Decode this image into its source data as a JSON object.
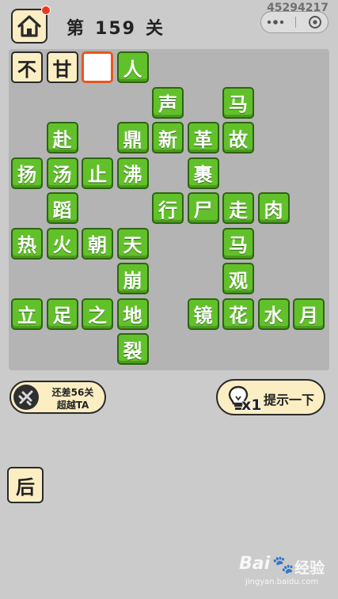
{
  "header": {
    "level_prefix": "第",
    "level_number": "159",
    "level_suffix": "关",
    "corner_id": "45294217"
  },
  "board": {
    "grid": [
      "不甘_人",
      "    声 马",
      " 赴 鼎新革故",
      "扬汤止沸 裹",
      " 蹈  行尸走肉",
      "热火朝天  马",
      "   崩  观",
      "立足之地 镜花水月",
      "   裂"
    ]
  },
  "progress": {
    "line1": "还差56关",
    "line2": "超越TA"
  },
  "hint": {
    "count": "x1",
    "label": "提示一下"
  },
  "side_button": {
    "label": "后"
  },
  "watermark": {
    "brand": "Bai",
    "brand_cn": "经验",
    "url": "jingyan.baidu.com"
  },
  "colors": {
    "tile_green": "#62c12a",
    "tile_cream": "#fbeec3",
    "empty_border": "#e8561f",
    "background": "#cbcbcb"
  }
}
